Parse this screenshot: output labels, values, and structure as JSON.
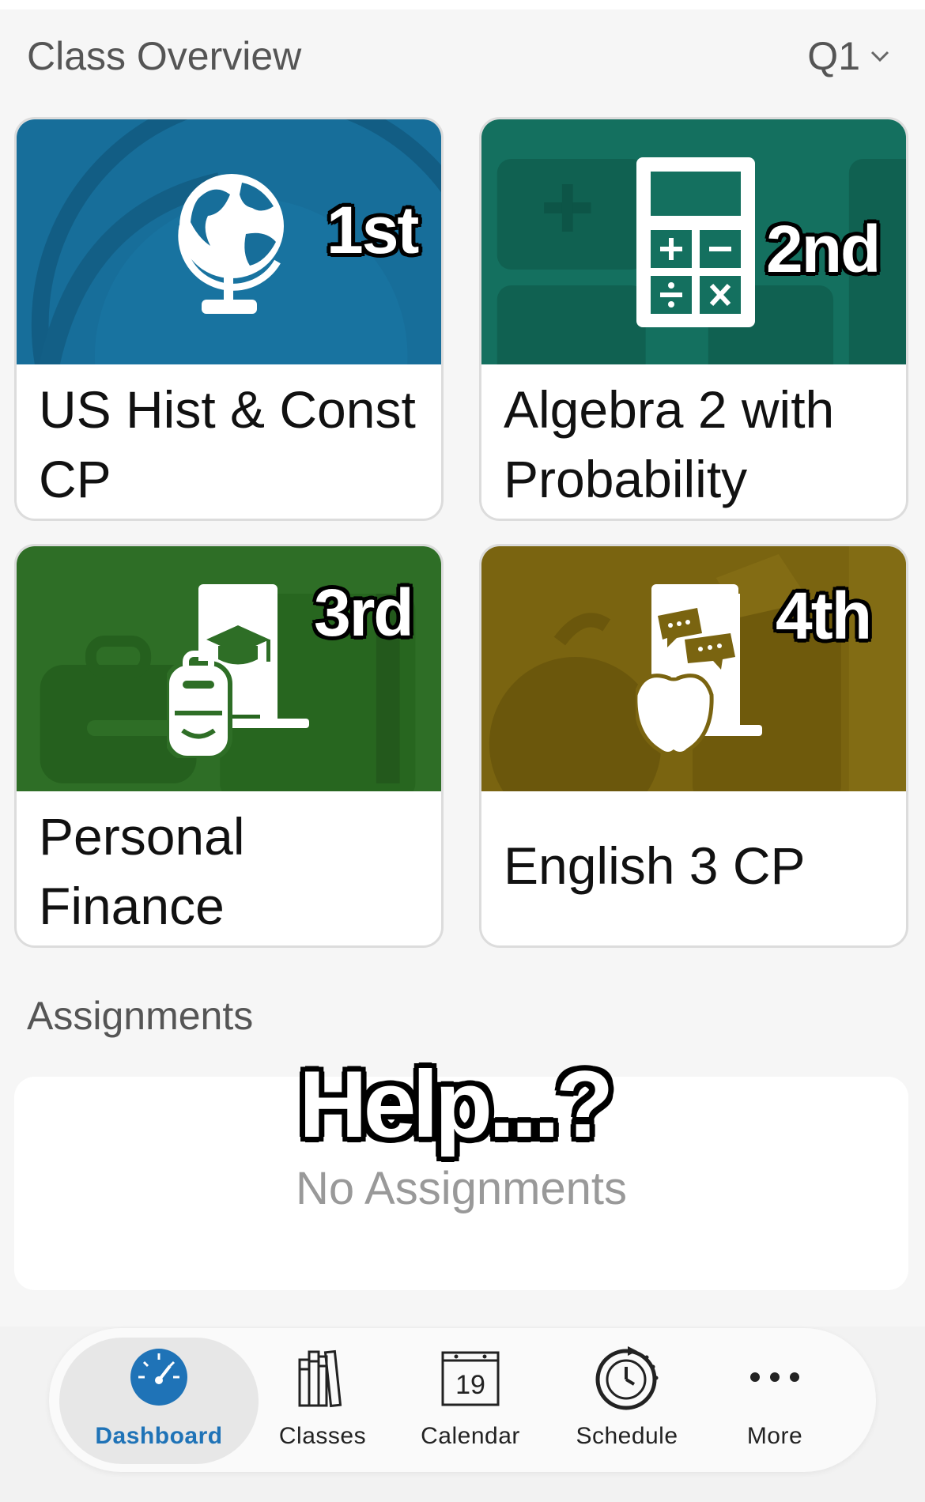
{
  "header": {
    "title": "Class Overview",
    "quarter": "Q1"
  },
  "classes": [
    {
      "period": "1st",
      "name": "US Hist & Const CP",
      "icon": "globe-icon",
      "color": "#176e9a"
    },
    {
      "period": "2nd",
      "name": "Algebra 2 with Probability",
      "icon": "calculator-icon",
      "color": "#14705f"
    },
    {
      "period": "3rd",
      "name": "Personal Finance",
      "icon": "backpack-book-icon",
      "color": "#2e6e26"
    },
    {
      "period": "4th",
      "name": "English 3 CP",
      "icon": "apple-book-icon",
      "color": "#7a6410"
    }
  ],
  "assignments": {
    "title": "Assignments",
    "empty_text": "No Assignments",
    "overlay_text": "Help...?"
  },
  "tabs": [
    {
      "label": "Dashboard",
      "icon": "dashboard-gauge-icon",
      "active": true,
      "color": "#1f73b7"
    },
    {
      "label": "Classes",
      "icon": "books-icon"
    },
    {
      "label": "Calendar",
      "icon": "calendar-icon",
      "day": "19"
    },
    {
      "label": "Schedule",
      "icon": "schedule-clock-icon"
    },
    {
      "label": "More",
      "icon": "more-dots-icon"
    }
  ]
}
